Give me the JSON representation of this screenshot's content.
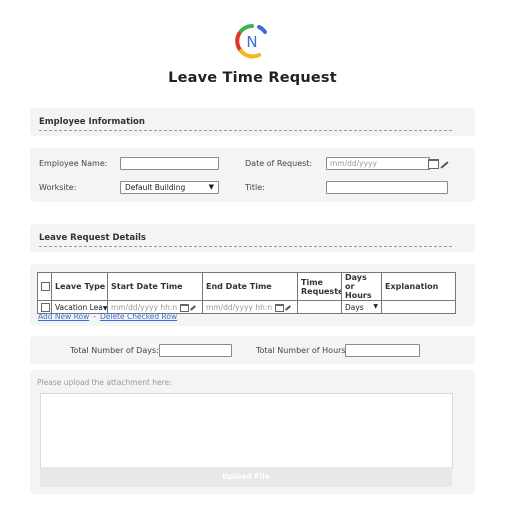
{
  "header": {
    "title": "Leave Time Request",
    "logo_letter": "N"
  },
  "employee_section": {
    "title": "Employee Information",
    "employee_name_label": "Employee Name:",
    "employee_name_value": "",
    "date_of_request_label": "Date of Request:",
    "date_of_request_placeholder": "mm/dd/yyyy",
    "worksite_label": "Worksite:",
    "worksite_value": "Default Building",
    "title_label": "Title:",
    "title_value": ""
  },
  "leave_section": {
    "title": "Leave Request Details",
    "columns": [
      "Leave Type",
      "Start Date Time",
      "End Date Time",
      "Time Requested",
      "Days or Hours",
      "Explanation"
    ],
    "row": {
      "leave_type": "Vacation Lea",
      "start_placeholder": "mm/dd/yyyy hh:n",
      "end_placeholder": "mm/dd/yyyy hh:n",
      "time_requested": "",
      "days_or_hours": "Days",
      "explanation": ""
    },
    "add_row_label": "Add New Row",
    "separator": "-",
    "delete_row_label": "Delete Checked Row"
  },
  "totals": {
    "days_label": "Total Number of Days:",
    "days_value": "",
    "hours_label": "Total Number of Hours:",
    "hours_value": ""
  },
  "upload": {
    "label": "Please upload the attachment here:",
    "button_label": "Upload File"
  },
  "colors": {
    "link": "#3a6fd8",
    "panel": "#f4f4f4",
    "logo_green": "#3bb44a",
    "logo_red": "#e2332b",
    "logo_yellow": "#f5b51c",
    "logo_blue": "#3a6fd8"
  }
}
